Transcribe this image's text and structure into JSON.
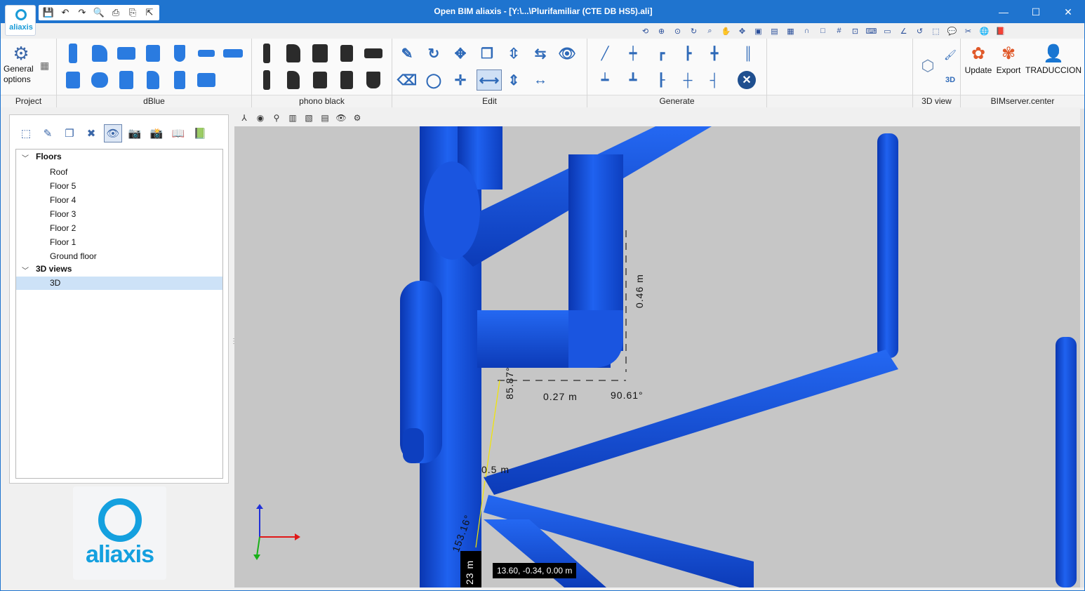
{
  "window": {
    "title": "Open BIM aliaxis - [Y:\\...\\Plurifamiliar (CTE DB HS5).ali]",
    "controls": [
      "—",
      "☐",
      "✕"
    ]
  },
  "app_logo_text": "aliaxis",
  "ribbon": {
    "groups": [
      {
        "id": "project",
        "label": "Project"
      },
      {
        "id": "dblue",
        "label": "dBlue"
      },
      {
        "id": "phono",
        "label": "phono black"
      },
      {
        "id": "edit",
        "label": "Edit"
      },
      {
        "id": "generate",
        "label": "Generate"
      },
      {
        "id": "view3d",
        "label": "3D view"
      },
      {
        "id": "bim",
        "label": "BIMserver.center"
      }
    ],
    "general_options_label": "General options",
    "update_label": "Update",
    "export_label": "Export",
    "traduccion_label": "TRADUCCION"
  },
  "tree": {
    "floors_label": "Floors",
    "floors": [
      "Roof",
      "Floor 5",
      "Floor 4",
      "Floor 3",
      "Floor 2",
      "Floor 1",
      "Ground floor"
    ],
    "views_label": "3D views",
    "views": [
      "3D"
    ],
    "selected": "3D"
  },
  "brand": "aliaxis",
  "dimensions": {
    "vertical": "0.46 m",
    "horizontal": "0.27 m",
    "angle_right": "90.61°",
    "angle_left": "85.87°",
    "length_short": "0.5 m",
    "angle_bottom": "153.16°",
    "length_bottom": "23 m"
  },
  "cursor_coords": "13.60, -0.34, 0.00 m",
  "colors": {
    "titlebar": "#1f74cf",
    "pipe": "#1756d8",
    "viewport_bg": "#c6c6c6",
    "brand": "#14a0df"
  }
}
